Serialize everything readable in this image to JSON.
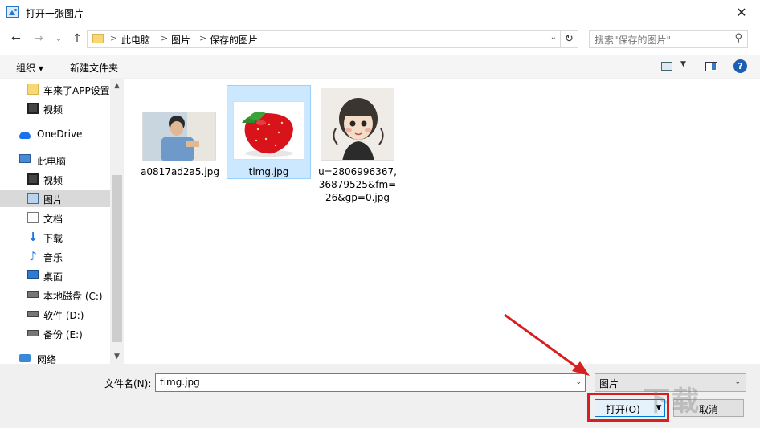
{
  "window": {
    "title": "打开一张图片",
    "close_glyph": "✕"
  },
  "nav": {
    "back_glyph": "←",
    "forward_glyph": "→",
    "recent_glyph": "⌄",
    "up_glyph": "↑",
    "breadcrumb": [
      "此电脑",
      "图片",
      "保存的图片"
    ],
    "separator": ">",
    "search_placeholder": "搜索\"保存的图片\"",
    "refresh_glyph": "↻",
    "dropdown_glyph": "⌄",
    "search_glyph": "⚲"
  },
  "toolbar": {
    "organize": "组织 ▾",
    "new_folder": "新建文件夹",
    "view_drop": "▼",
    "help": "?"
  },
  "sidebar": {
    "items": [
      {
        "label": "车来了APP设置",
        "icon": "folder-icon"
      },
      {
        "label": "视频",
        "icon": "video-icon"
      },
      {
        "label": "OneDrive",
        "icon": "cloud-icon"
      },
      {
        "label": "此电脑",
        "icon": "computer-icon"
      },
      {
        "label": "视频",
        "icon": "video-icon"
      },
      {
        "label": "图片",
        "icon": "picture-icon"
      },
      {
        "label": "文档",
        "icon": "document-icon"
      },
      {
        "label": "下载",
        "icon": "download-icon"
      },
      {
        "label": "音乐",
        "icon": "music-icon"
      },
      {
        "label": "桌面",
        "icon": "desktop-icon"
      },
      {
        "label": "本地磁盘 (C:)",
        "icon": "drive-icon"
      },
      {
        "label": "软件 (D:)",
        "icon": "drive-icon"
      },
      {
        "label": "备份 (E:)",
        "icon": "drive-icon"
      },
      {
        "label": "网络",
        "icon": "network-icon"
      }
    ],
    "scroll_up": "▲",
    "scroll_down": "▼"
  },
  "files": [
    {
      "name": "a0817ad2a5.jpg"
    },
    {
      "name": "timg.jpg"
    },
    {
      "name": "u=2806996367,\n36879525&fm=\n26&gp=0.jpg"
    }
  ],
  "footer": {
    "filename_label": "文件名(N):",
    "filename_value": "timg.jpg",
    "filetype_value": "图片",
    "open_label": "打开(O)",
    "open_split": "▼",
    "cancel_label": "取消",
    "dropdown_glyph": "⌄"
  },
  "colors": {
    "accent": "#0078d7",
    "annotation": "#d62020"
  }
}
